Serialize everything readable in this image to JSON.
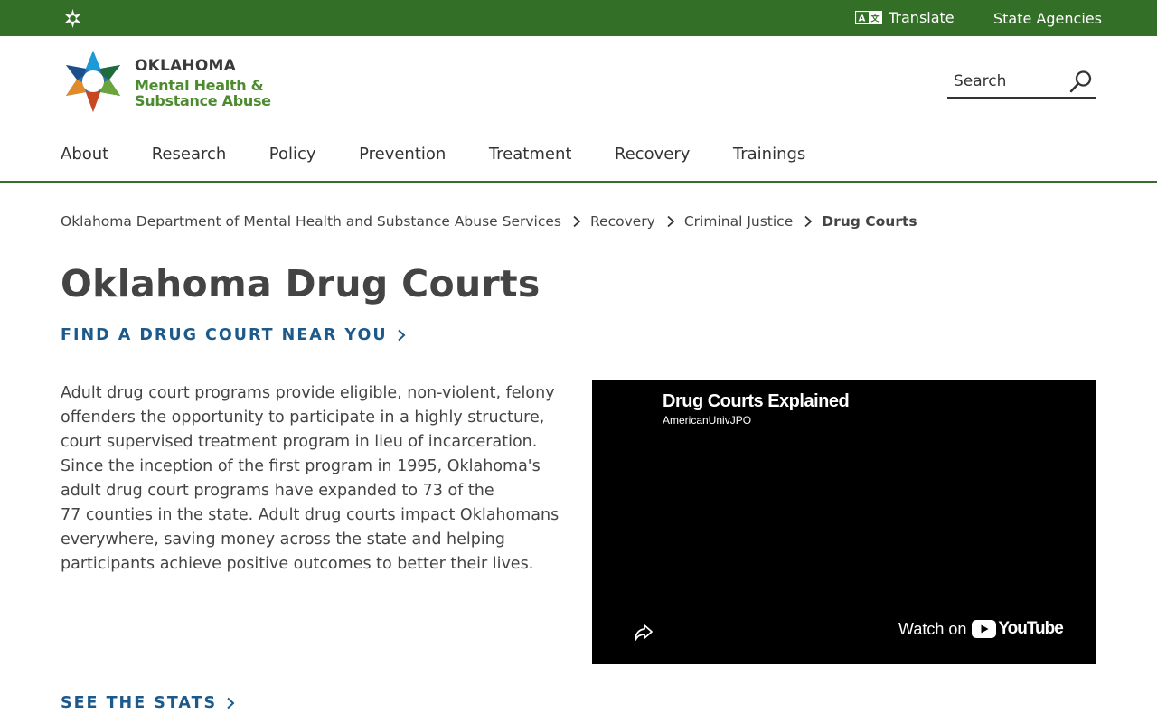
{
  "topbar": {
    "translate_label": "Translate",
    "agencies_label": "State Agencies",
    "bg_color": "#346f28"
  },
  "logo": {
    "line1": "OKLAHOMA",
    "line2": "Mental Health &",
    "line3": "Substance Abuse"
  },
  "search": {
    "placeholder": "Search"
  },
  "nav": {
    "items": [
      "About",
      "Research",
      "Policy",
      "Prevention",
      "Treatment",
      "Recovery",
      "Trainings"
    ]
  },
  "breadcrumb": {
    "items": [
      "Oklahoma Department of Mental Health and Substance Abuse Services",
      "Recovery",
      "Criminal Justice"
    ],
    "current": "Drug Courts"
  },
  "page": {
    "title": "Oklahoma Drug Courts",
    "find_link": "FIND A DRUG COURT NEAR YOU",
    "stats_link": "SEE THE STATS",
    "link_color": "#1d5a8c",
    "body_lines": [
      "Adult drug court programs provide eligible, non-violent, felony",
      "offenders the opportunity to participate in a highly structure,",
      "court supervised treatment program in lieu of incarceration.",
      "Since the inception of the first program in 1995, Oklahoma's",
      "adult drug court programs have expanded to 73 of the",
      "77 counties in the state. Adult drug courts impact Oklahomans",
      "everywhere, saving money across the state and helping",
      "participants achieve positive outcomes to better their lives."
    ]
  },
  "video": {
    "title": "Drug Courts Explained",
    "channel": "AmericanUnivJPO",
    "watch_on": "Watch on",
    "youtube": "YouTube"
  }
}
